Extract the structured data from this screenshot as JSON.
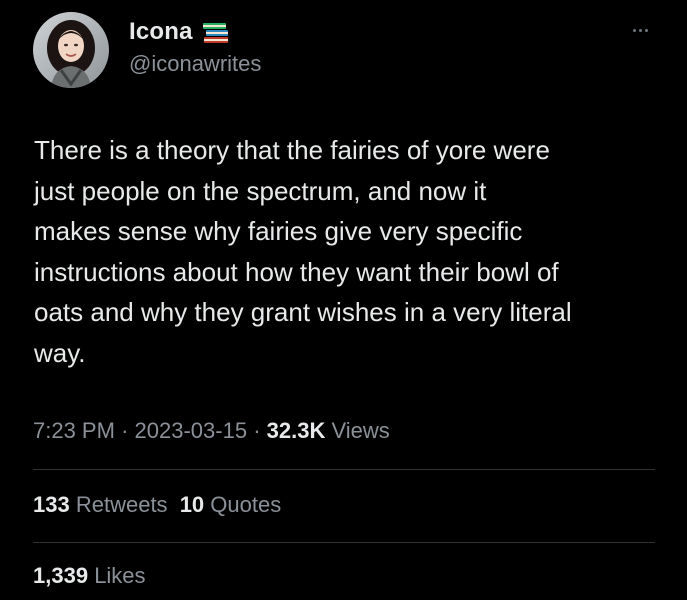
{
  "author": {
    "display_name": "Icona",
    "handle": "@iconawrites",
    "name_emoji_icon": "books-icon"
  },
  "more_icon": "more-horizontal-icon",
  "tweet": {
    "text_lines": [
      "There is a theory that the fairies of yore were",
      "just people on the spectrum, and now it",
      "makes sense why fairies give very specific",
      "instructions about how they want their bowl of",
      "oats and why they grant wishes in a very literal",
      "way."
    ]
  },
  "meta": {
    "time": "7:23 PM",
    "separator": "·",
    "date": "2023-03-15",
    "views_count": "32.3K",
    "views_label": "Views"
  },
  "stats": {
    "retweets_count": "133",
    "retweets_label": "Retweets",
    "quotes_count": "10",
    "quotes_label": "Quotes",
    "likes_count": "1,339",
    "likes_label": "Likes"
  },
  "colors": {
    "background": "#000000",
    "primary_text": "#e7e9ea",
    "secondary_text": "#8b9199",
    "divider": "#2f3336"
  }
}
